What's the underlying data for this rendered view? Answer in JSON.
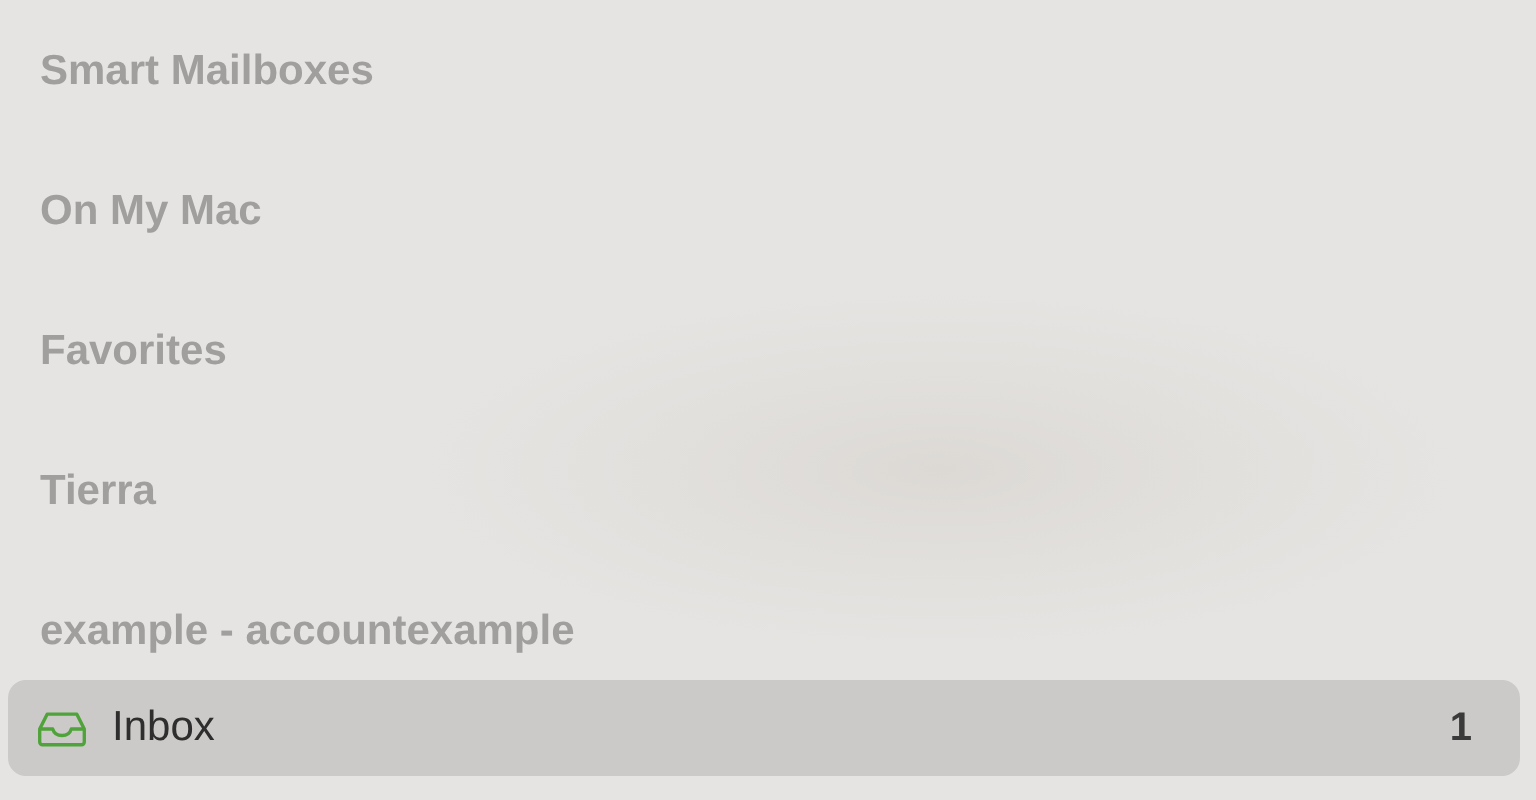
{
  "sidebar": {
    "sections": [
      {
        "label": "Smart Mailboxes"
      },
      {
        "label": "On My Mac"
      },
      {
        "label": "Favorites"
      },
      {
        "label": "Tierra"
      },
      {
        "label": "example - accountexample"
      }
    ],
    "mailboxes": [
      {
        "label": "Inbox",
        "count": "1",
        "selected": true
      }
    ]
  }
}
